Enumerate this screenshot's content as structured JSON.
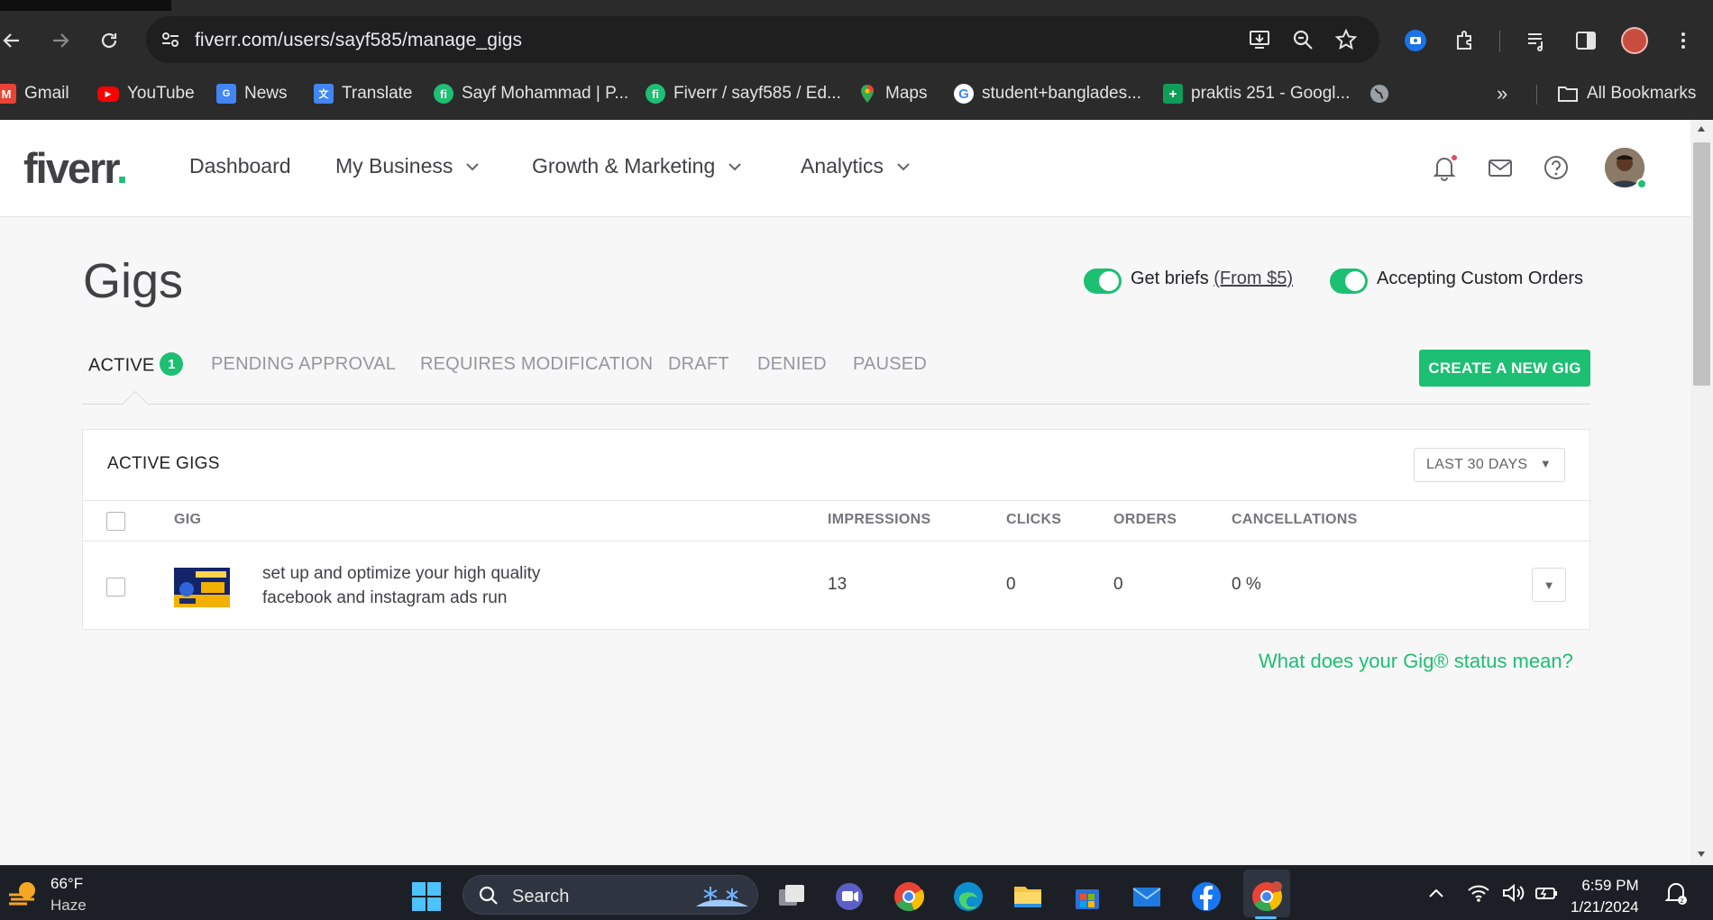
{
  "browser": {
    "url": "fiverr.com/users/sayf585/manage_gigs",
    "bookmarks": [
      {
        "label": "Gmail",
        "icon": "gmail-icon"
      },
      {
        "label": "YouTube",
        "icon": "youtube-icon"
      },
      {
        "label": "News",
        "icon": "news-icon"
      },
      {
        "label": "Translate",
        "icon": "translate-icon"
      },
      {
        "label": "Sayf Mohammad | P...",
        "icon": "fiverr-icon"
      },
      {
        "label": "Fiverr / sayf585 / Ed...",
        "icon": "fiverr-icon"
      },
      {
        "label": "Maps",
        "icon": "maps-icon"
      },
      {
        "label": "student+banglades...",
        "icon": "google-icon"
      },
      {
        "label": "praktis 251 - Googl...",
        "icon": "sheets-icon"
      }
    ],
    "all_bookmarks": "All Bookmarks",
    "overflow": "»"
  },
  "header": {
    "logo": "fiverr",
    "logo_dot": ".",
    "nav": {
      "dashboard": "Dashboard",
      "my_business": "My Business",
      "growth": "Growth & Marketing",
      "analytics": "Analytics"
    }
  },
  "gigs": {
    "title": "Gigs",
    "toggle_briefs": {
      "label": "Get briefs ",
      "link": "(From $5)",
      "on": true
    },
    "toggle_custom": {
      "label": "Accepting Custom Orders",
      "on": true
    },
    "tabs": {
      "active": "ACTIVE",
      "active_count": "1",
      "pending": "PENDING APPROVAL",
      "requires": "REQUIRES MODIFICATION",
      "draft": "DRAFT",
      "denied": "DENIED",
      "paused": "PAUSED"
    },
    "create_button": "CREATE A NEW GIG",
    "panel": {
      "title": "ACTIVE GIGS",
      "period": "LAST 30 DAYS",
      "columns": {
        "gig": "GIG",
        "impressions": "IMPRESSIONS",
        "clicks": "CLICKS",
        "orders": "ORDERS",
        "cancellations": "CANCELLATIONS"
      },
      "rows": [
        {
          "title": "set up and optimize your high quality facebook and instagram ads run",
          "impressions": "13",
          "clicks": "0",
          "orders": "0",
          "cancellations": "0 %"
        }
      ]
    },
    "help_link": "What does your Gig® status mean?"
  },
  "taskbar": {
    "temperature": "66°F",
    "condition": "Haze",
    "search": "Search",
    "time": "6:59 PM",
    "date": "1/21/2024"
  },
  "colors": {
    "fiverr_green": "#1dbf73",
    "text_dark": "#404145",
    "chrome_bg": "#2b2b2b"
  }
}
